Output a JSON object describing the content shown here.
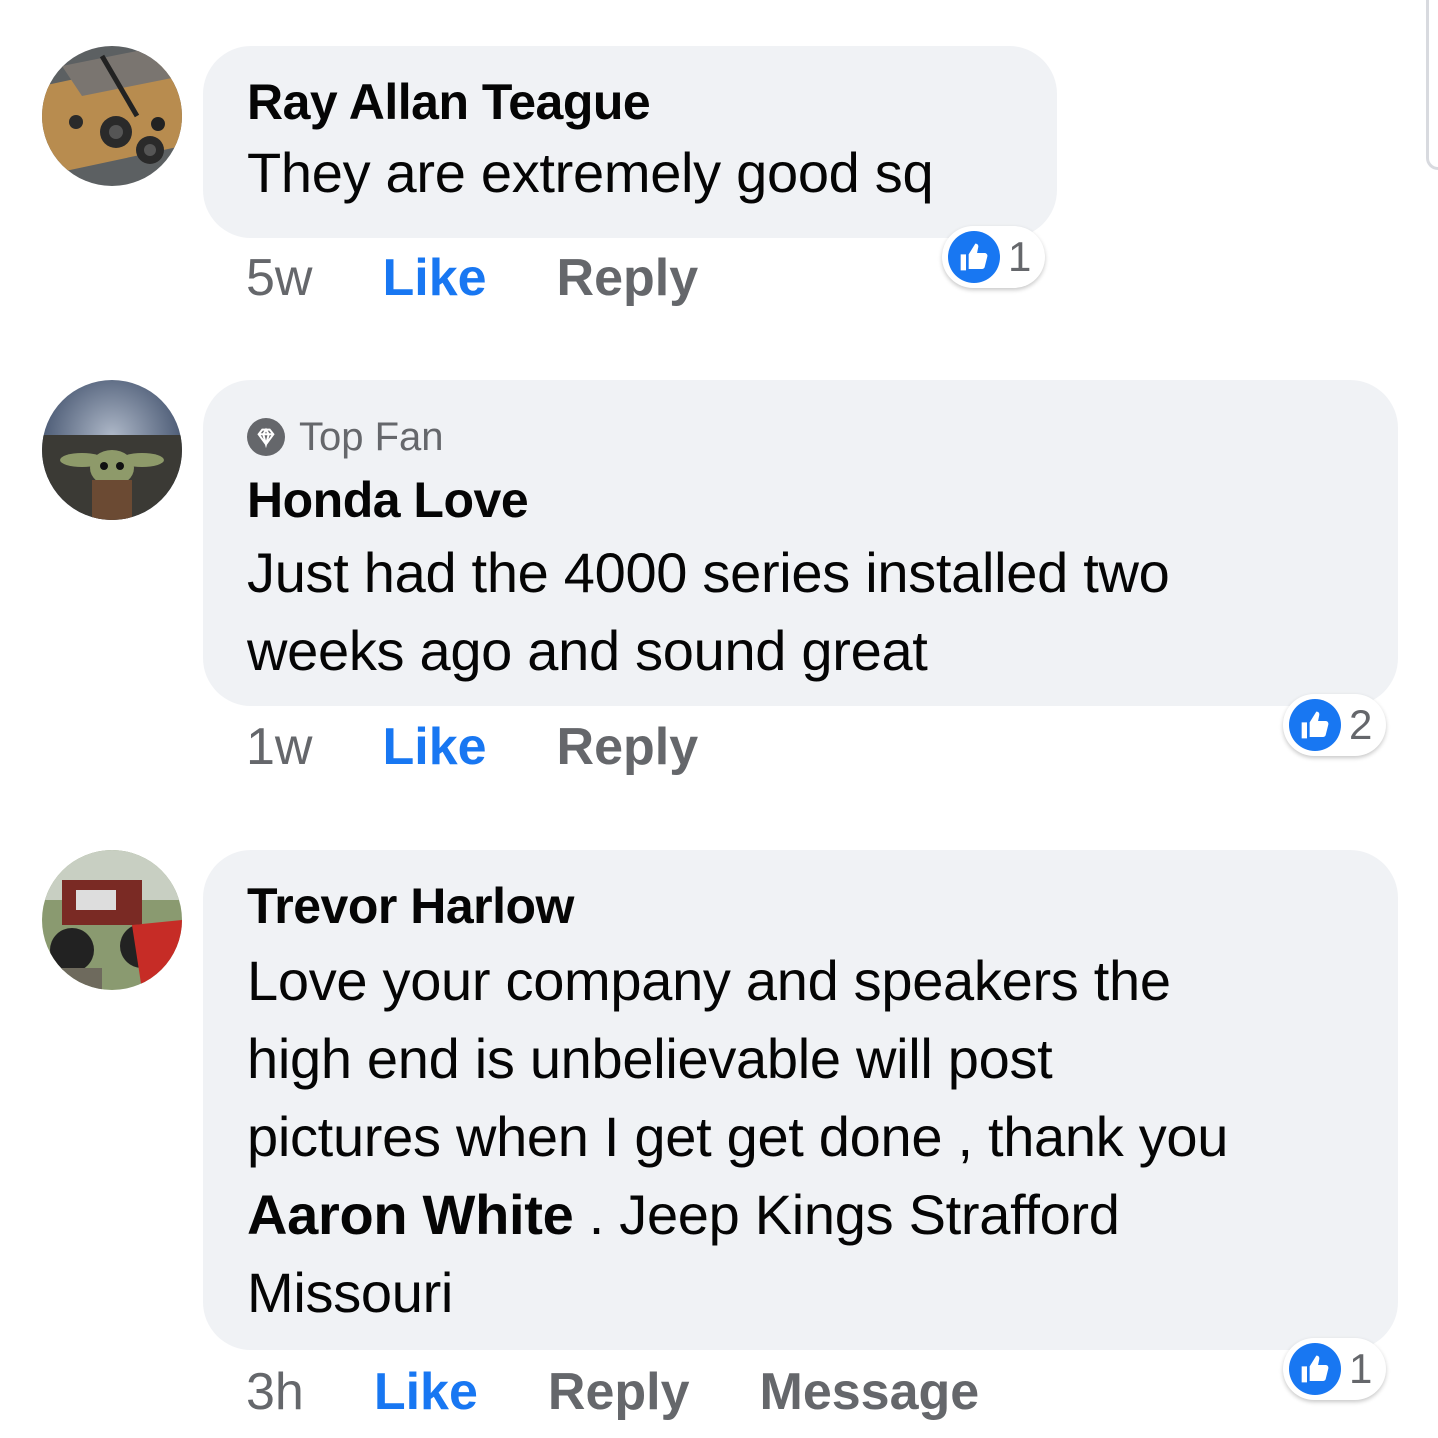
{
  "comments": [
    {
      "author": "Ray Allan Teague",
      "text": "They are extremely good sq",
      "time": "5w",
      "like_label": "Like",
      "reply_label": "Reply",
      "reaction_count": "1"
    },
    {
      "badge": "Top Fan",
      "author": "Honda Love",
      "text_line1": "Just had the 4000 series installed two",
      "text_line2": "weeks ago and sound great",
      "time": "1w",
      "like_label": "Like",
      "reply_label": "Reply",
      "reaction_count": "2"
    },
    {
      "author": "Trevor Harlow",
      "text_line1": "Love your company and speakers the",
      "text_line2": "high end is unbelievable will post",
      "text_line3": "pictures when I get get done , thank you",
      "mention": "Aaron White",
      "text_after_mention": " . Jeep Kings Strafford",
      "text_line5": "Missouri",
      "time": "3h",
      "like_label": "Like",
      "reply_label": "Reply",
      "message_label": "Message",
      "reaction_count": "1"
    }
  ],
  "colors": {
    "bubble_bg": "#f0f2f5",
    "like_blue": "#1877f2",
    "meta_gray": "#65676b"
  },
  "icons": {
    "reaction": "thumbs-up-icon",
    "badge": "diamond-icon"
  }
}
